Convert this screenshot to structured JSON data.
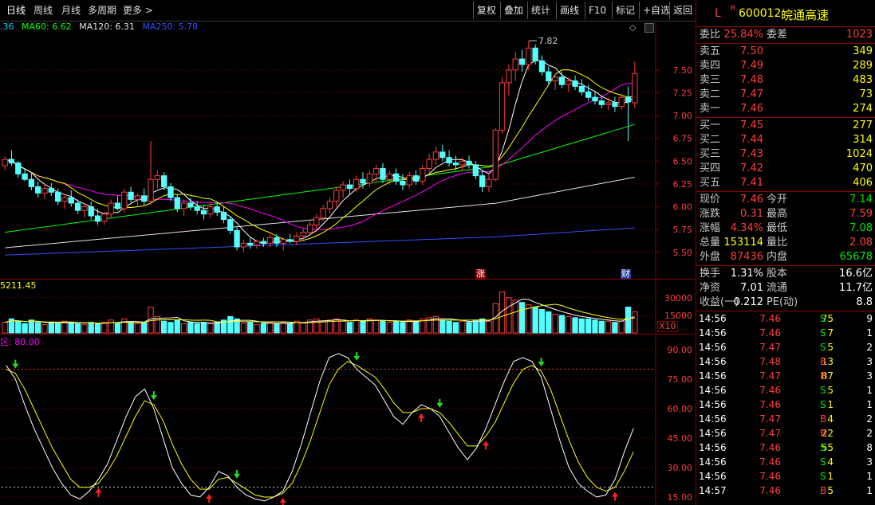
{
  "toolbar": {
    "periods": [
      "日线",
      "周线",
      "月线",
      "多周期",
      "更多 >"
    ],
    "buttons": [
      "复权",
      "叠加",
      "统计",
      "画线",
      "F10",
      "标记",
      "+自选",
      "返回"
    ]
  },
  "main_chart": {
    "legend": [
      {
        "text": ".36",
        "color": "#00d0ff"
      },
      {
        "text": "MA60: 6.62",
        "color": "#00ff00"
      },
      {
        "text": "MA120: 6.31",
        "color": "#e0e0e0"
      },
      {
        "text": "MA250: 5.78",
        "color": "#3050ff"
      }
    ],
    "high_label": "7.82",
    "y_ticks": [
      "7.50",
      "7.25",
      "7.00",
      "6.75",
      "6.50",
      "6.25",
      "6.00",
      "5.75",
      "5.50"
    ],
    "markers": [
      "涨",
      "财"
    ]
  },
  "volume_chart": {
    "legend": "5211.45",
    "y_ticks": [
      "30000",
      "15000"
    ],
    "unit": "X10"
  },
  "kdj_chart": {
    "legend": "区: 80.00",
    "y_ticks": [
      "90.00",
      "75.00",
      "60.00",
      "45.00",
      "30.00",
      "15.00"
    ]
  },
  "quote": {
    "flag": "L",
    "badge": "R",
    "code": "600012",
    "name": "皖通高速",
    "weibi_label": "委比",
    "weibi": "25.84%",
    "weicha_label": "委差",
    "weicha": "1023",
    "asks": [
      {
        "label": "卖五",
        "price": "7.50",
        "vol": "349"
      },
      {
        "label": "卖四",
        "price": "7.49",
        "vol": "289"
      },
      {
        "label": "卖三",
        "price": "7.48",
        "vol": "483"
      },
      {
        "label": "卖二",
        "price": "7.47",
        "vol": "73"
      },
      {
        "label": "卖一",
        "price": "7.46",
        "vol": "274"
      }
    ],
    "bids": [
      {
        "label": "买一",
        "price": "7.45",
        "vol": "277"
      },
      {
        "label": "买二",
        "price": "7.44",
        "vol": "314"
      },
      {
        "label": "买三",
        "price": "7.43",
        "vol": "1024"
      },
      {
        "label": "买四",
        "price": "7.42",
        "vol": "470"
      },
      {
        "label": "买五",
        "price": "7.41",
        "vol": "406"
      }
    ],
    "stats": [
      {
        "l1": "现价",
        "v1": "7.46",
        "c1": "red",
        "l2": "今开",
        "v2": "7.14",
        "c2": "green"
      },
      {
        "l1": "涨跌",
        "v1": "0.31",
        "c1": "red",
        "l2": "最高",
        "v2": "7.59",
        "c2": "red"
      },
      {
        "l1": "涨幅",
        "v1": "4.34%",
        "c1": "red",
        "l2": "最低",
        "v2": "7.08",
        "c2": "green"
      },
      {
        "l1": "总量",
        "v1": "153114",
        "c1": "yellow",
        "l2": "量比",
        "v2": "2.08",
        "c2": "red"
      },
      {
        "l1": "外盘",
        "v1": "87436",
        "c1": "red",
        "l2": "内盘",
        "v2": "65678",
        "c2": "green"
      }
    ],
    "fund": [
      {
        "l1": "换手",
        "v1": "1.31%",
        "l2": "股本",
        "v2": "16.6亿"
      },
      {
        "l1": "净资",
        "v1": "7.01",
        "l2": "流通",
        "v2": "11.7亿"
      },
      {
        "l1": "收益(一)",
        "v1": "0.212",
        "l2": "PE(动)",
        "v2": "8.8"
      }
    ],
    "ticks": [
      {
        "time": "14:56",
        "price": "7.46",
        "pc": "red",
        "vol": "75",
        "vc": "yellow",
        "bs": "S",
        "bc": "green",
        "n": "9"
      },
      {
        "time": "14:56",
        "price": "7.46",
        "pc": "red",
        "vol": "7",
        "vc": "yellow",
        "bs": "S",
        "bc": "green",
        "n": "1"
      },
      {
        "time": "14:56",
        "price": "7.47",
        "pc": "red",
        "vol": "5",
        "vc": "yellow",
        "bs": "S",
        "bc": "green",
        "n": "2"
      },
      {
        "time": "14:56",
        "price": "7.48",
        "pc": "red",
        "vol": "13",
        "vc": "yellow",
        "bs": "B",
        "bc": "red",
        "n": "3"
      },
      {
        "time": "14:56",
        "price": "7.47",
        "pc": "red",
        "vol": "87",
        "vc": "yellow",
        "bs": "B",
        "bc": "red",
        "n": "3"
      },
      {
        "time": "14:56",
        "price": "7.46",
        "pc": "red",
        "vol": "5",
        "vc": "yellow",
        "bs": "S",
        "bc": "green",
        "n": "1"
      },
      {
        "time": "14:56",
        "price": "7.46",
        "pc": "red",
        "vol": "1",
        "vc": "yellow",
        "bs": "S",
        "bc": "green",
        "n": "1"
      },
      {
        "time": "14:56",
        "price": "7.47",
        "pc": "red",
        "vol": "4",
        "vc": "yellow",
        "bs": "B",
        "bc": "red",
        "n": "2"
      },
      {
        "time": "14:56",
        "price": "7.47",
        "pc": "red",
        "vol": "22",
        "vc": "yellow",
        "bs": "B",
        "bc": "red",
        "n": "2"
      },
      {
        "time": "14:56",
        "price": "7.46",
        "pc": "red",
        "vol": "55",
        "vc": "yellow",
        "bs": "S",
        "bc": "green",
        "n": "8"
      },
      {
        "time": "14:56",
        "price": "7.46",
        "pc": "red",
        "vol": "4",
        "vc": "yellow",
        "bs": "S",
        "bc": "green",
        "n": "3"
      },
      {
        "time": "14:56",
        "price": "7.46",
        "pc": "red",
        "vol": "1",
        "vc": "yellow",
        "bs": "S",
        "bc": "green",
        "n": "1"
      },
      {
        "time": "14:57",
        "price": "7.46",
        "pc": "red",
        "vol": "5",
        "vc": "yellow",
        "bs": "B",
        "bc": "red",
        "n": "1"
      }
    ]
  },
  "colors": {
    "up": "#ff3c3c",
    "down": "#54ffff",
    "grid": "#8b0000",
    "ma5": "#ffffff",
    "ma10": "#ffff00",
    "ma20": "#ff00ff",
    "ma60": "#00ff00",
    "ma120": "#e0e0e0",
    "ma250": "#3050ff"
  },
  "chart_data": {
    "type": "candlestick",
    "y_range": [
      5.35,
      7.9
    ],
    "candles": [
      [
        6.45,
        6.55,
        6.4,
        6.52
      ],
      [
        6.52,
        6.62,
        6.45,
        6.48
      ],
      [
        6.48,
        6.5,
        6.32,
        6.36
      ],
      [
        6.36,
        6.42,
        6.28,
        6.3
      ],
      [
        6.3,
        6.38,
        6.18,
        6.22
      ],
      [
        6.22,
        6.28,
        6.1,
        6.15
      ],
      [
        6.15,
        6.25,
        6.08,
        6.2
      ],
      [
        6.2,
        6.26,
        6.12,
        6.16
      ],
      [
        6.16,
        6.2,
        6.02,
        6.06
      ],
      [
        6.06,
        6.14,
        5.98,
        6.1
      ],
      [
        6.1,
        6.18,
        6.0,
        6.04
      ],
      [
        6.04,
        6.08,
        5.92,
        5.96
      ],
      [
        5.96,
        6.04,
        5.88,
        6.0
      ],
      [
        6.0,
        6.06,
        5.86,
        5.9
      ],
      [
        5.9,
        5.98,
        5.8,
        5.84
      ],
      [
        5.84,
        5.94,
        5.8,
        5.92
      ],
      [
        5.92,
        6.08,
        5.88,
        6.04
      ],
      [
        6.04,
        6.12,
        5.96,
        5.98
      ],
      [
        5.98,
        6.2,
        5.94,
        6.16
      ],
      [
        6.16,
        6.22,
        6.05,
        6.08
      ],
      [
        6.08,
        6.15,
        6.0,
        6.12
      ],
      [
        6.12,
        6.2,
        6.02,
        6.06
      ],
      [
        6.06,
        6.72,
        6.02,
        6.3
      ],
      [
        6.3,
        6.4,
        6.2,
        6.34
      ],
      [
        6.34,
        6.38,
        6.18,
        6.22
      ],
      [
        6.22,
        6.26,
        6.06,
        6.1
      ],
      [
        6.1,
        6.14,
        5.94,
        5.98
      ],
      [
        5.98,
        6.08,
        5.9,
        6.04
      ],
      [
        6.04,
        6.1,
        5.96,
        6.0
      ],
      [
        6.0,
        6.06,
        5.92,
        5.96
      ],
      [
        5.96,
        6.02,
        5.86,
        5.92
      ],
      [
        5.92,
        6.04,
        5.88,
        6.0
      ],
      [
        6.0,
        6.06,
        5.9,
        5.94
      ],
      [
        5.94,
        6.0,
        5.82,
        5.86
      ],
      [
        5.86,
        5.9,
        5.7,
        5.74
      ],
      [
        5.74,
        5.78,
        5.52,
        5.56
      ],
      [
        5.56,
        5.64,
        5.5,
        5.6
      ],
      [
        5.6,
        5.66,
        5.54,
        5.58
      ],
      [
        5.58,
        5.64,
        5.54,
        5.62
      ],
      [
        5.62,
        5.66,
        5.56,
        5.6
      ],
      [
        5.6,
        5.7,
        5.56,
        5.66
      ],
      [
        5.66,
        5.7,
        5.56,
        5.6
      ],
      [
        5.6,
        5.66,
        5.52,
        5.64
      ],
      [
        5.64,
        5.7,
        5.6,
        5.62
      ],
      [
        5.62,
        5.72,
        5.58,
        5.68
      ],
      [
        5.68,
        5.76,
        5.62,
        5.72
      ],
      [
        5.72,
        5.84,
        5.68,
        5.8
      ],
      [
        5.8,
        5.92,
        5.74,
        5.88
      ],
      [
        5.88,
        6.02,
        5.84,
        5.98
      ],
      [
        5.98,
        6.1,
        5.92,
        6.06
      ],
      [
        6.06,
        6.22,
        6.0,
        6.18
      ],
      [
        6.18,
        6.28,
        6.1,
        6.24
      ],
      [
        6.24,
        6.3,
        6.14,
        6.2
      ],
      [
        6.2,
        6.34,
        6.16,
        6.3
      ],
      [
        6.3,
        6.38,
        6.2,
        6.26
      ],
      [
        6.26,
        6.4,
        6.22,
        6.36
      ],
      [
        6.36,
        6.46,
        6.28,
        6.42
      ],
      [
        6.42,
        6.48,
        6.26,
        6.3
      ],
      [
        6.3,
        6.4,
        6.24,
        6.36
      ],
      [
        6.36,
        6.42,
        6.24,
        6.28
      ],
      [
        6.28,
        6.36,
        6.18,
        6.24
      ],
      [
        6.24,
        6.38,
        6.2,
        6.34
      ],
      [
        6.34,
        6.4,
        6.24,
        6.28
      ],
      [
        6.28,
        6.46,
        6.24,
        6.42
      ],
      [
        6.42,
        6.58,
        6.36,
        6.52
      ],
      [
        6.52,
        6.66,
        6.46,
        6.6
      ],
      [
        6.6,
        6.68,
        6.5,
        6.54
      ],
      [
        6.54,
        6.62,
        6.44,
        6.48
      ],
      [
        6.48,
        6.56,
        6.4,
        6.46
      ],
      [
        6.46,
        6.54,
        6.4,
        6.5
      ],
      [
        6.5,
        6.56,
        6.42,
        6.46
      ],
      [
        6.46,
        6.5,
        6.3,
        6.34
      ],
      [
        6.34,
        6.4,
        6.16,
        6.22
      ],
      [
        6.22,
        6.36,
        6.16,
        6.3
      ],
      [
        6.3,
        6.86,
        6.28,
        6.84
      ],
      [
        6.84,
        7.42,
        6.8,
        7.36
      ],
      [
        7.36,
        7.56,
        7.22,
        7.5
      ],
      [
        7.5,
        7.7,
        7.38,
        7.62
      ],
      [
        7.62,
        7.72,
        7.48,
        7.56
      ],
      [
        7.56,
        7.82,
        7.5,
        7.74
      ],
      [
        7.74,
        7.78,
        7.56,
        7.6
      ],
      [
        7.6,
        7.66,
        7.44,
        7.48
      ],
      [
        7.48,
        7.54,
        7.34,
        7.38
      ],
      [
        7.38,
        7.46,
        7.28,
        7.42
      ],
      [
        7.42,
        7.48,
        7.3,
        7.34
      ],
      [
        7.34,
        7.42,
        7.26,
        7.38
      ],
      [
        7.38,
        7.44,
        7.28,
        7.32
      ],
      [
        7.32,
        7.4,
        7.22,
        7.26
      ],
      [
        7.26,
        7.34,
        7.16,
        7.2
      ],
      [
        7.2,
        7.26,
        7.12,
        7.16
      ],
      [
        7.16,
        7.22,
        7.08,
        7.12
      ],
      [
        7.12,
        7.2,
        7.06,
        7.14
      ],
      [
        7.14,
        7.2,
        7.04,
        7.1
      ],
      [
        7.1,
        7.24,
        7.06,
        7.2
      ],
      [
        7.2,
        7.32,
        6.72,
        7.15
      ],
      [
        7.14,
        7.59,
        7.08,
        7.46
      ]
    ],
    "volumes": [
      9,
      12,
      10,
      8,
      11,
      9,
      7,
      9,
      8,
      10,
      9,
      8,
      7,
      9,
      8,
      9,
      11,
      8,
      12,
      9,
      8,
      9,
      22,
      14,
      10,
      9,
      11,
      8,
      9,
      8,
      9,
      8,
      9,
      11,
      14,
      12,
      8,
      9,
      7,
      8,
      9,
      8,
      9,
      8,
      10,
      9,
      11,
      12,
      10,
      11,
      12,
      10,
      9,
      11,
      10,
      12,
      11,
      10,
      9,
      10,
      9,
      11,
      10,
      12,
      13,
      14,
      11,
      10,
      9,
      10,
      9,
      11,
      12,
      10,
      25,
      35,
      30,
      28,
      26,
      24,
      22,
      20,
      18,
      16,
      15,
      14,
      13,
      12,
      12,
      11,
      10,
      10,
      9,
      10,
      22,
      18
    ],
    "kdj": {
      "k": [
        82,
        75,
        62,
        50,
        40,
        30,
        22,
        16,
        14,
        18,
        24,
        32,
        44,
        56,
        66,
        70,
        60,
        45,
        30,
        22,
        16,
        15,
        20,
        28,
        26,
        20,
        16,
        14,
        13,
        15,
        18,
        28,
        42,
        58,
        74,
        86,
        88,
        86,
        80,
        76,
        72,
        64,
        56,
        52,
        58,
        62,
        60,
        56,
        48,
        40,
        34,
        40,
        50,
        62,
        74,
        84,
        86,
        84,
        76,
        60,
        44,
        30,
        22,
        18,
        15,
        16,
        24,
        38,
        50
      ],
      "d": [
        80,
        78,
        70,
        60,
        50,
        40,
        32,
        24,
        20,
        20,
        22,
        28,
        36,
        46,
        56,
        64,
        62,
        54,
        42,
        32,
        24,
        19,
        19,
        24,
        25,
        22,
        19,
        16,
        15,
        15,
        17,
        22,
        32,
        44,
        58,
        72,
        80,
        84,
        82,
        79,
        76,
        70,
        63,
        58,
        58,
        60,
        60,
        58,
        53,
        47,
        41,
        41,
        46,
        53,
        63,
        73,
        80,
        82,
        79,
        70,
        57,
        44,
        33,
        25,
        20,
        18,
        20,
        28,
        38
      ]
    }
  }
}
